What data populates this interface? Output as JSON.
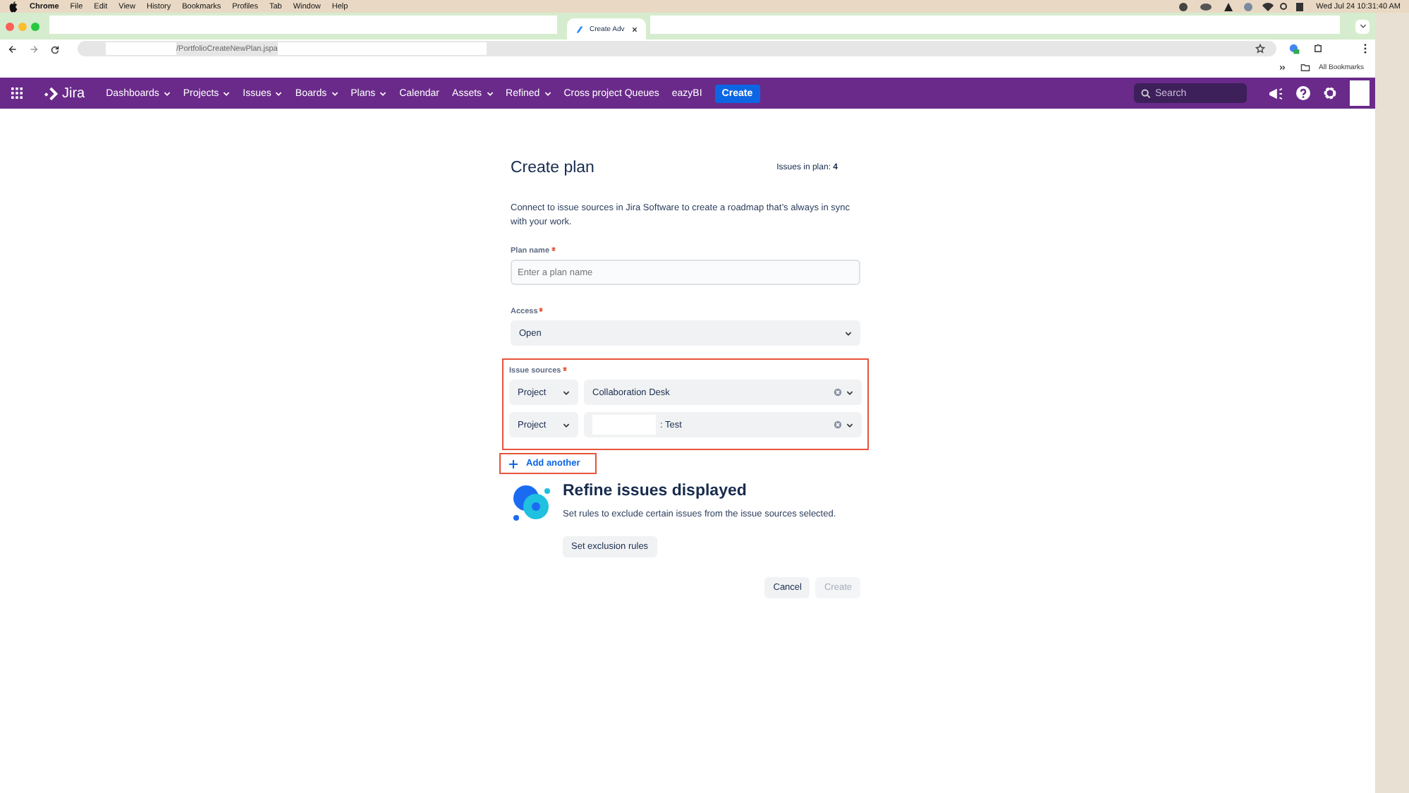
{
  "menubar": {
    "app": "Chrome",
    "items": [
      "File",
      "Edit",
      "View",
      "History",
      "Bookmarks",
      "Profiles",
      "Tab",
      "Window",
      "Help"
    ],
    "clock": "Wed Jul 24  10:31:40 AM"
  },
  "browser": {
    "tab_title": "Create Adv",
    "url": "/PortfolioCreateNewPlan.jspa",
    "bookmarks_label": "All Bookmarks"
  },
  "nav": {
    "product": "Jira",
    "items": [
      {
        "label": "Dashboards",
        "dropdown": true
      },
      {
        "label": "Projects",
        "dropdown": true
      },
      {
        "label": "Issues",
        "dropdown": true
      },
      {
        "label": "Boards",
        "dropdown": true
      },
      {
        "label": "Plans",
        "dropdown": true
      },
      {
        "label": "Calendar",
        "dropdown": false
      },
      {
        "label": "Assets",
        "dropdown": true
      },
      {
        "label": "Refined",
        "dropdown": true
      },
      {
        "label": "Cross project Queues",
        "dropdown": false
      },
      {
        "label": "eazyBI",
        "dropdown": false
      }
    ],
    "create": "Create",
    "search_placeholder": "Search"
  },
  "form": {
    "title": "Create plan",
    "issues_label": "Issues in plan:",
    "issues_count": "4",
    "description": "Connect to issue sources in Jira Software to create a roadmap that’s always in sync with your work.",
    "plan_name": {
      "label": "Plan name",
      "required": true,
      "placeholder": "Enter a plan name"
    },
    "access": {
      "label": "Access",
      "required": true,
      "value": "Open"
    },
    "issue_sources": {
      "label": "Issue sources",
      "required": true,
      "rows": [
        {
          "type": "Project",
          "value": "Collaboration Desk",
          "redacted": false
        },
        {
          "type": "Project",
          "value": ": Test",
          "redacted": true
        }
      ]
    },
    "add_another": "Add another",
    "refine": {
      "title": "Refine issues displayed",
      "text": "Set rules to exclude certain issues from the issue sources selected.",
      "button": "Set exclusion rules"
    },
    "buttons": [
      {
        "label": "Cancel",
        "disabled": false
      },
      {
        "label": "Create",
        "disabled": true
      }
    ]
  }
}
